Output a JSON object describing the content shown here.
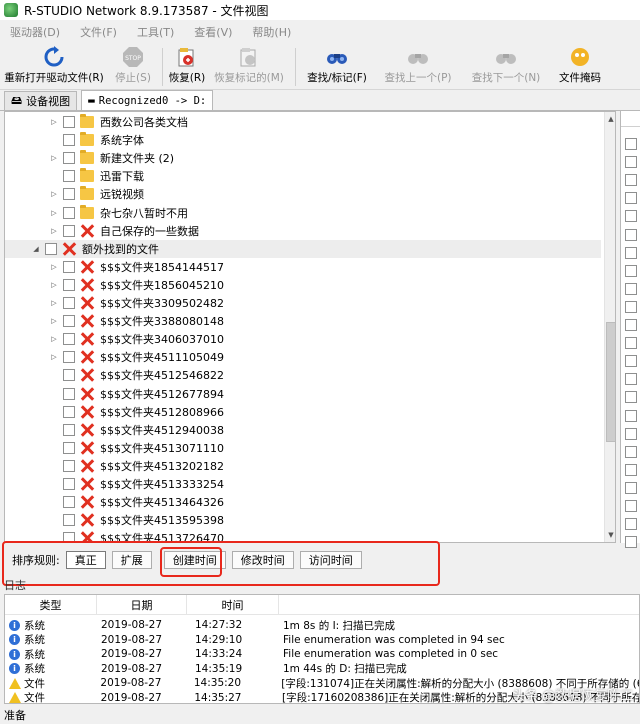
{
  "window": {
    "title": "R-STUDIO Network 8.9.173587 - 文件视图"
  },
  "menu": [
    "驱动器(D)",
    "文件(F)",
    "工具(T)",
    "查看(V)",
    "帮助(H)"
  ],
  "toolbar": [
    {
      "label": "重新打开驱动文件(R)",
      "icon": "refresh-icon",
      "enabled": true
    },
    {
      "label": "停止(S)",
      "icon": "stop-icon",
      "enabled": false
    },
    {
      "label": "恢复(R)",
      "icon": "recover-icon",
      "enabled": true
    },
    {
      "label": "恢复标记的(M)",
      "icon": "recover-marked-icon",
      "enabled": false
    },
    {
      "label": "查找/标记(F)",
      "icon": "binoculars-icon",
      "enabled": true
    },
    {
      "label": "查找上一个(P)",
      "icon": "find-prev-icon",
      "enabled": false
    },
    {
      "label": "查找下一个(N)",
      "icon": "find-next-icon",
      "enabled": false
    },
    {
      "label": "文件掩码",
      "icon": "file-mask-icon",
      "enabled": true
    }
  ],
  "tabs": [
    {
      "label": "设备视图",
      "icon": "device-icon"
    },
    {
      "label": "Recognized0 -> D:",
      "icon": "drive-icon"
    }
  ],
  "tree": [
    {
      "label": "西数公司各类文档",
      "type": "folder",
      "expander": true,
      "indent": 1
    },
    {
      "label": "系统字体",
      "type": "folder",
      "expander": false,
      "indent": 1
    },
    {
      "label": "新建文件夹 (2)",
      "type": "folder",
      "expander": true,
      "indent": 1
    },
    {
      "label": "迅雷下载",
      "type": "folder",
      "expander": false,
      "indent": 1
    },
    {
      "label": "远锐视频",
      "type": "folder",
      "expander": true,
      "indent": 1
    },
    {
      "label": "杂七杂八暂时不用",
      "type": "folder",
      "expander": true,
      "indent": 1
    },
    {
      "label": "自己保存的一些数据",
      "type": "deleted",
      "expander": true,
      "indent": 1
    },
    {
      "label": "额外找到的文件",
      "type": "deleted",
      "expander": "open",
      "indent": 0,
      "selected": true
    },
    {
      "label": "$$$文件夹1854144517",
      "type": "deleted",
      "expander": true,
      "indent": 1
    },
    {
      "label": "$$$文件夹1856045210",
      "type": "deleted",
      "expander": true,
      "indent": 1
    },
    {
      "label": "$$$文件夹3309502482",
      "type": "deleted",
      "expander": true,
      "indent": 1
    },
    {
      "label": "$$$文件夹3388080148",
      "type": "deleted",
      "expander": true,
      "indent": 1
    },
    {
      "label": "$$$文件夹3406037010",
      "type": "deleted",
      "expander": true,
      "indent": 1
    },
    {
      "label": "$$$文件夹4511105049",
      "type": "deleted",
      "expander": true,
      "indent": 1
    },
    {
      "label": "$$$文件夹4512546822",
      "type": "deleted",
      "expander": false,
      "indent": 1
    },
    {
      "label": "$$$文件夹4512677894",
      "type": "deleted",
      "expander": false,
      "indent": 1
    },
    {
      "label": "$$$文件夹4512808966",
      "type": "deleted",
      "expander": false,
      "indent": 1
    },
    {
      "label": "$$$文件夹4512940038",
      "type": "deleted",
      "expander": false,
      "indent": 1
    },
    {
      "label": "$$$文件夹4513071110",
      "type": "deleted",
      "expander": false,
      "indent": 1
    },
    {
      "label": "$$$文件夹4513202182",
      "type": "deleted",
      "expander": false,
      "indent": 1
    },
    {
      "label": "$$$文件夹4513333254",
      "type": "deleted",
      "expander": false,
      "indent": 1
    },
    {
      "label": "$$$文件夹4513464326",
      "type": "deleted",
      "expander": false,
      "indent": 1
    },
    {
      "label": "$$$文件夹4513595398",
      "type": "deleted",
      "expander": false,
      "indent": 1
    },
    {
      "label": "$$$文件夹4513726470",
      "type": "deleted",
      "expander": false,
      "indent": 1
    }
  ],
  "sort": {
    "label": "排序规则:",
    "buttons": [
      "真正",
      "扩展",
      "创建时间",
      "修改时间",
      "访问时间"
    ],
    "active": 0
  },
  "log": {
    "title": "日志",
    "columns": [
      "类型",
      "日期",
      "时间",
      ""
    ],
    "rows": [
      {
        "icon": "info",
        "type": "系统",
        "date": "2019-08-27",
        "time": "14:27:32",
        "message": "1m 8s 的 I: 扫描已完成"
      },
      {
        "icon": "info",
        "type": "系统",
        "date": "2019-08-27",
        "time": "14:29:10",
        "message": "File enumeration was completed in 94 sec"
      },
      {
        "icon": "info",
        "type": "系统",
        "date": "2019-08-27",
        "time": "14:33:24",
        "message": "File enumeration was completed in 0 sec"
      },
      {
        "icon": "info",
        "type": "系统",
        "date": "2019-08-27",
        "time": "14:35:19",
        "message": "1m 44s 的 D: 扫描已完成"
      },
      {
        "icon": "warning",
        "type": "文件",
        "date": "2019-08-27",
        "time": "14:35:20",
        "message": "[字段:131074]正在关闭属性:解析的分配大小 (8388608) 不同于所存储的 (6"
      },
      {
        "icon": "warning",
        "type": "文件",
        "date": "2019-08-27",
        "time": "14:35:27",
        "message": "[字段:17160208386]正在关闭属性:解析的分配大小 (8388608) 不同于所存"
      }
    ]
  },
  "status": {
    "text": "准备"
  },
  "watermark": "头条 @数据恢复陈工"
}
